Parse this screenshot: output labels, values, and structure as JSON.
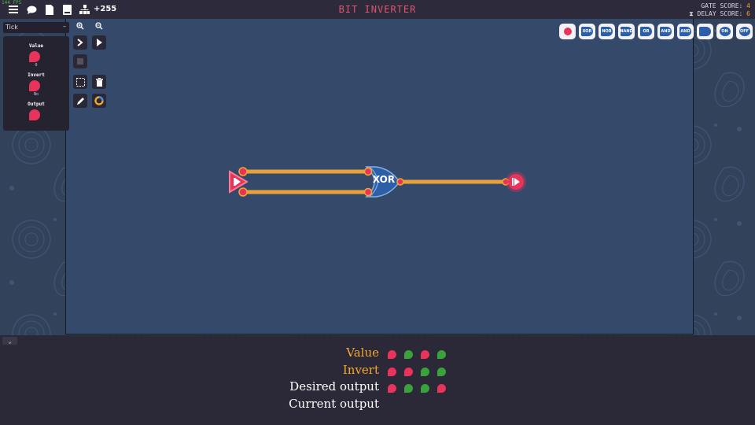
{
  "topbar": {
    "fps": "144 FPS",
    "score_delta": "+255",
    "title": "BIT INVERTER",
    "gate_score_label": "GATE SCORE:",
    "gate_score": "4",
    "delay_score_label": "DELAY SCORE:",
    "delay_score": "6",
    "icons": [
      "menu-icon",
      "chat-icon",
      "document-icon",
      "book-icon",
      "hierarchy-icon"
    ]
  },
  "sidebar": {
    "tick_label": "Tick",
    "io": [
      {
        "label": "Value",
        "sub": "0"
      },
      {
        "label": "Invert",
        "sub": "No"
      },
      {
        "label": "Output",
        "sub": ""
      }
    ]
  },
  "toolbar": {
    "tools": [
      "zoom-in-icon",
      "zoom-out-icon",
      "step-icon",
      "play-icon",
      "stop-icon",
      "select-icon",
      "delete-icon",
      "pen-icon",
      "color-wheel-icon"
    ]
  },
  "palette": {
    "gates": [
      "",
      "XOR",
      "NOR",
      "NAND",
      "OR",
      "AND",
      "AND",
      "",
      "ON",
      "OFF"
    ]
  },
  "circuit": {
    "gate_label": "XOR",
    "wire_color": "#e8a23c",
    "io_color": "#e8335a",
    "gate_color": "#2d5fa8"
  },
  "truth_table": {
    "rows": [
      {
        "label": "Value",
        "color": "#f4a72a",
        "bits": [
          "r",
          "g",
          "r",
          "g"
        ]
      },
      {
        "label": "Invert",
        "color": "#f4a72a",
        "bits": [
          "r",
          "r",
          "g",
          "g"
        ]
      },
      {
        "label": "Desired output",
        "color": "#ffffff",
        "bits": [
          "r",
          "g",
          "g",
          "r"
        ]
      },
      {
        "label": "Current output",
        "color": "#ffffff",
        "bits": []
      }
    ]
  }
}
